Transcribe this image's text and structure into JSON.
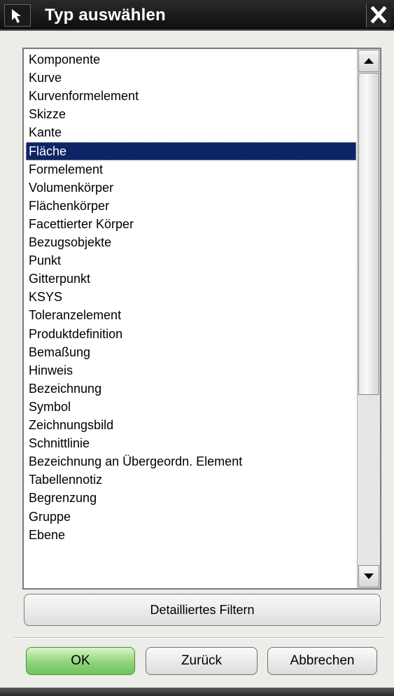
{
  "window": {
    "title": "Typ auswählen",
    "icons": {
      "title": "select-arrow-icon",
      "close": "close-icon"
    }
  },
  "list": {
    "items": [
      "Komponente",
      "Kurve",
      "Kurvenformelement",
      "Skizze",
      "Kante",
      "Fläche",
      "Formelement",
      "Volumenkörper",
      "Flächenkörper",
      "Facettierter Körper",
      "Bezugsobjekte",
      "Punkt",
      "Gitterpunkt",
      "KSYS",
      "Toleranzelement",
      "Produktdefinition",
      "Bemaßung",
      "Hinweis",
      "Bezeichnung",
      "Symbol",
      "Zeichnungsbild",
      "Schnittlinie",
      "Bezeichnung an Übergeordn. Element",
      "Tabellennotiz",
      "Begrenzung",
      "Gruppe",
      "Ebene"
    ],
    "selected": "Fläche",
    "scroll_icons": {
      "up": "scroll-up-arrow-icon",
      "down": "scroll-down-arrow-icon"
    }
  },
  "buttons": {
    "filter": "Detailliertes Filtern",
    "ok": "OK",
    "back": "Zurück",
    "cancel": "Abbrechen"
  },
  "colors": {
    "selection": "#0d2566",
    "ok_button": "#8ed47c",
    "titlebar": "#111111"
  }
}
